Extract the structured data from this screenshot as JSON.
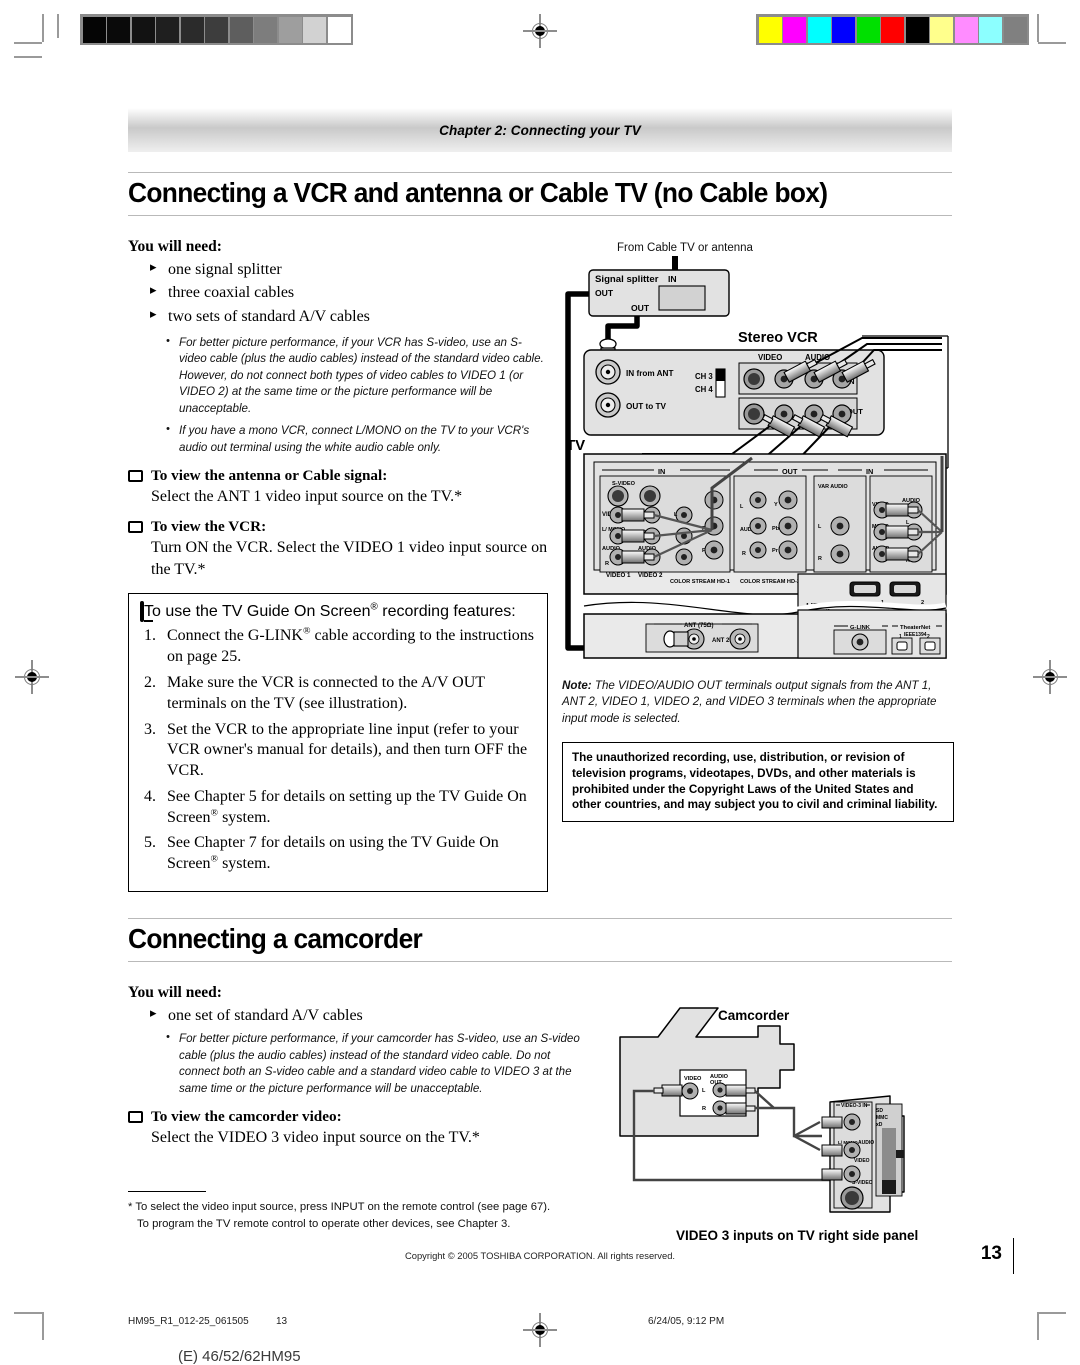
{
  "page": {
    "chapter_band": "Chapter 2: Connecting your TV",
    "page_number": "13",
    "copyright": "Copyright © 2005 TOSHIBA CORPORATION. All rights reserved.",
    "footer_file": "HM95_R1_012-25_061505",
    "footer_page": "13",
    "footer_date": "6/24/05, 9:12 PM",
    "model_line": "(E) 46/52/62HM95"
  },
  "section1": {
    "title": "Connecting a VCR and antenna or Cable TV (no Cable box)",
    "you_will_need_label": "You will need:",
    "needs": [
      "one signal splitter",
      "three coaxial cables",
      "two sets of standard A/V cables"
    ],
    "subnotes": [
      "For better picture performance, if your VCR has S-video, use an S-video cable (plus the audio cables) instead of the standard video cable. However, do not connect both types of video cables to VIDEO 1 (or VIDEO 2) at the same time or the picture performance will be unacceptable.",
      "If you have a mono VCR, connect L/MONO on the TV to your VCR's audio out terminal using the white audio cable only."
    ],
    "antenna_heading": "To view the antenna or Cable signal:",
    "antenna_body": "Select the ANT 1 video input source on the TV.*",
    "vcr_heading": "To view the VCR:",
    "vcr_body": "Turn ON the VCR. Select the VIDEO 1 video input source on the TV.*",
    "tvguide_heading": "To use the TV Guide On Screen® recording features:",
    "steps": [
      "Connect the G-LINK® cable according to the instructions on page 25.",
      "Make sure the VCR is connected to the A/V OUT terminals on the TV (see illustration).",
      "Set the VCR to the appropriate line input (refer to your VCR owner's manual for details), and then turn OFF the VCR.",
      "See Chapter 5 for details on setting up the TV Guide On Screen® system.",
      "See Chapter 7 for details on using the TV Guide On Screen® system."
    ],
    "note_label": "Note:",
    "note_body": "The VIDEO/AUDIO OUT terminals output signals from the ANT 1, ANT 2, VIDEO 1, VIDEO 2, and VIDEO 3 terminals when the appropriate input mode is selected.",
    "warning": "The unauthorized recording, use, distribution, or revision of television programs, videotapes, DVDs, and other materials is prohibited under the Copyright Laws of the United States and other countries, and may subject you to civil and criminal liability."
  },
  "diagram1": {
    "source_label": "From Cable TV or antenna",
    "splitter_title": "Signal splitter",
    "splitter_in": "IN",
    "splitter_out1": "OUT",
    "splitter_out2": "OUT",
    "vcr_title": "Stereo VCR",
    "vcr_in_from_ant": "IN from ANT",
    "vcr_out_to_tv": "OUT to TV",
    "vcr_ch3": "CH 3",
    "vcr_ch4": "CH 4",
    "vcr_video": "VIDEO",
    "vcr_audio": "AUDIO",
    "vcr_l": "L",
    "vcr_r": "R",
    "vcr_in": "IN",
    "vcr_out": "OUT",
    "tv_title": "TV",
    "tv_in_left": "IN",
    "tv_out": "OUT",
    "tv_in_right": "IN",
    "svideo": "S-VIDEO",
    "video": "VIDEO",
    "l_mono": "L/ MONO",
    "mono": "MONO",
    "audio": "AUDIO",
    "r": "R",
    "l": "L",
    "y": "Y",
    "pb": "Pb",
    "pr": "Pr",
    "var_audio": "VAR AUDIO",
    "video1": "VIDEO 1",
    "video2": "VIDEO 2",
    "colorstream1": "COLOR STREAM HD-1",
    "colorstream2": "COLOR STREAM HD-2",
    "hdmi": "HDMI",
    "hdmi1": "1",
    "hdmi2": "2",
    "glink": "G-LINK",
    "theaternet": "TheaterNet",
    "ieee1394": "IEEE1394",
    "tn1": "1",
    "tn2": "2",
    "ant75": "ANT (75Ω)",
    "ant2": "ANT 2"
  },
  "section2": {
    "title": "Connecting a camcorder",
    "you_will_need_label": "You will need:",
    "needs": [
      "one set of standard A/V cables"
    ],
    "subnotes": [
      "For better picture performance, if your camcorder has S-video, use an S-video cable (plus the audio cables) instead of the standard video cable. Do not connect both an S-video cable and a standard video cable to VIDEO 3 at the same time or the picture performance will be unacceptable."
    ],
    "camcorder_heading": "To view the camcorder video:",
    "camcorder_body": "Select the VIDEO 3 video input source on the TV.*"
  },
  "diagram2": {
    "camcorder_title": "Camcorder",
    "video": "VIDEO",
    "audio_out": "AUDIO OUT",
    "l": "L",
    "r": "R",
    "panel_caption": "VIDEO 3 inputs on TV right side panel",
    "video3in": "VIDEO-3 IN",
    "sd": "SD",
    "mmc": "MMC",
    "xd": "xD",
    "panel_l": "L",
    "panel_lmono": "L/ MONO",
    "panel_audio": "AUDIO",
    "panel_video": "VIDEO",
    "panel_svideo": "S-VIDEO"
  },
  "footnote": {
    "line1": "* To select the video input source, press INPUT on the remote control (see page 67).",
    "line2": "To program the TV remote control to operate other devices, see Chapter 3."
  },
  "swatches": {
    "gray_scale": [
      "#050505",
      "#0a0a0a",
      "#121212",
      "#1f1f1f",
      "#2b2b2b",
      "#3d3d3d",
      "#5e5e5e",
      "#7d7d7d",
      "#9e9e9e",
      "#d2d2d2",
      "#ffffff"
    ],
    "colors": [
      "#ffff00",
      "#ff00ff",
      "#00ffff",
      "#0000ff",
      "#00e000",
      "#ff0000",
      "#000000",
      "#ffff8c",
      "#ff8cff",
      "#8cffff",
      "#808080"
    ]
  }
}
